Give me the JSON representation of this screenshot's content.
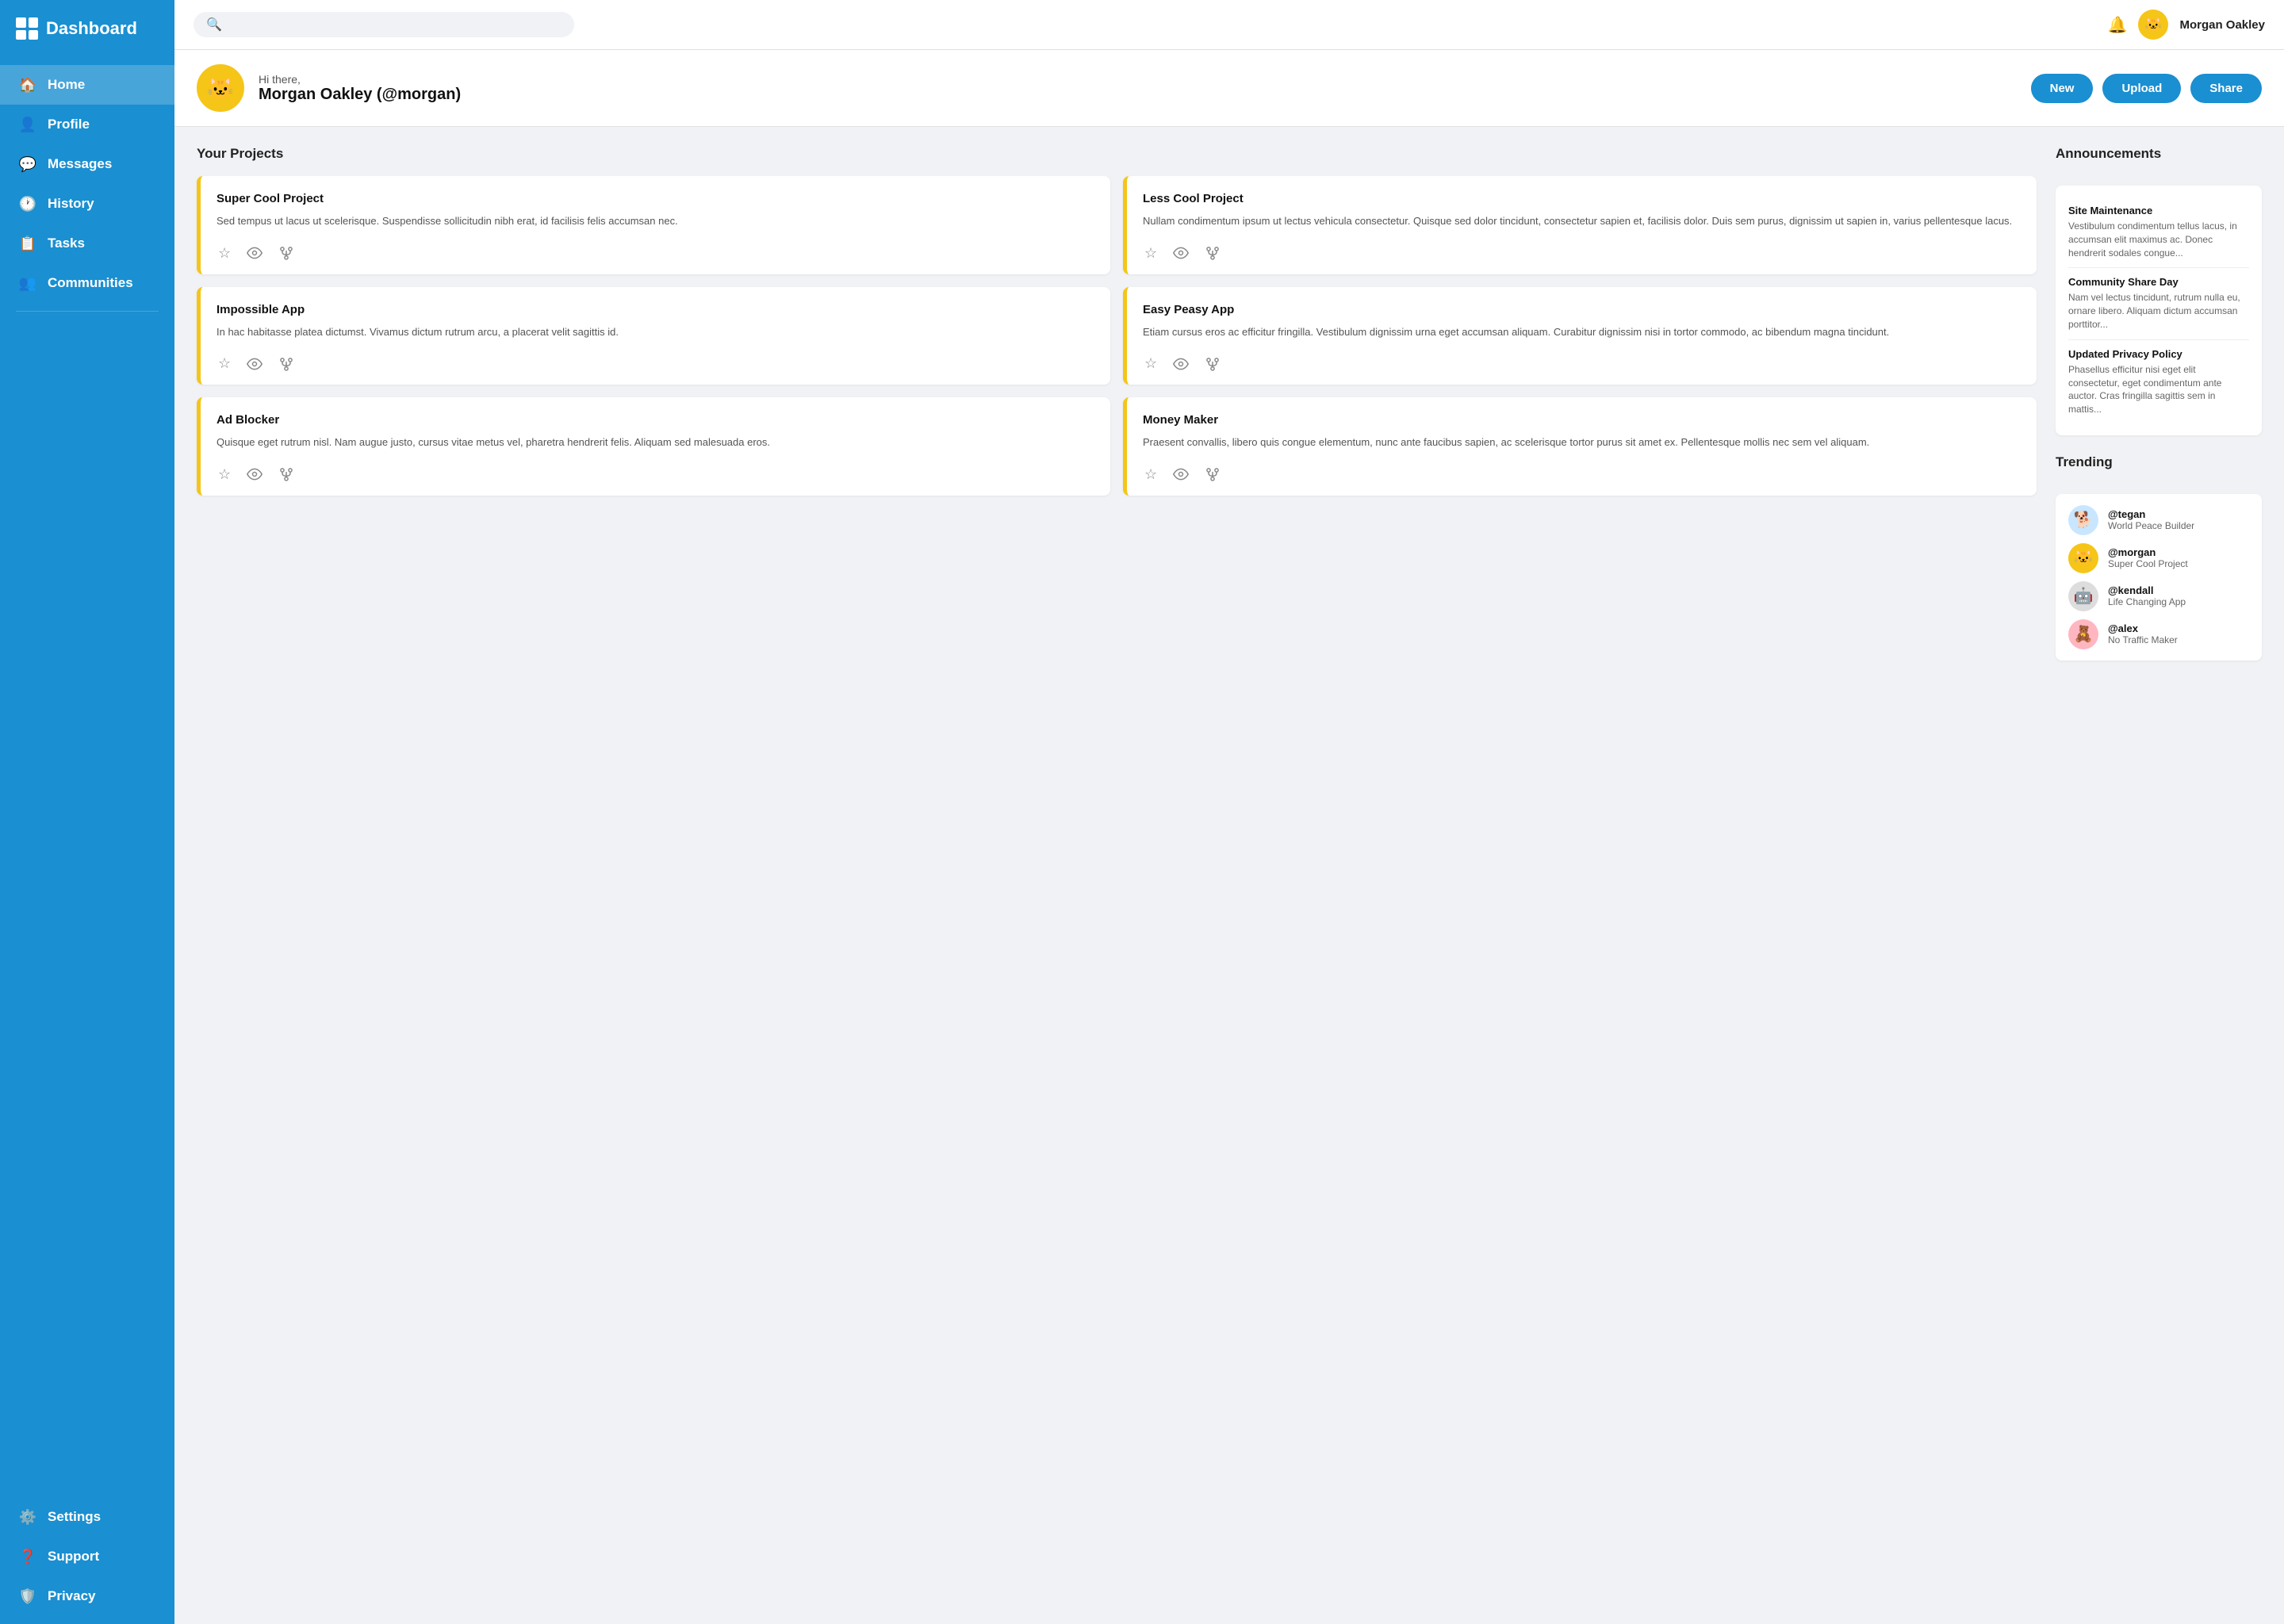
{
  "sidebar": {
    "title": "Dashboard",
    "items": [
      {
        "id": "home",
        "label": "Home",
        "icon": "🏠",
        "active": true
      },
      {
        "id": "profile",
        "label": "Profile",
        "icon": "👤"
      },
      {
        "id": "messages",
        "label": "Messages",
        "icon": "💬"
      },
      {
        "id": "history",
        "label": "History",
        "icon": "🕐"
      },
      {
        "id": "tasks",
        "label": "Tasks",
        "icon": "📋"
      },
      {
        "id": "communities",
        "label": "Communities",
        "icon": "👥"
      }
    ],
    "bottom_items": [
      {
        "id": "settings",
        "label": "Settings",
        "icon": "⚙️"
      },
      {
        "id": "support",
        "label": "Support",
        "icon": "❓"
      },
      {
        "id": "privacy",
        "label": "Privacy",
        "icon": "🛡️"
      }
    ]
  },
  "topbar": {
    "search_placeholder": "",
    "user_name": "Morgan Oakley",
    "user_emoji": "🐱"
  },
  "welcome": {
    "greeting": "Hi there,",
    "user_display": "Morgan Oakley (@morgan)",
    "user_emoji": "🐱",
    "buttons": [
      "New",
      "Upload",
      "Share"
    ]
  },
  "projects_title": "Your Projects",
  "projects": [
    {
      "title": "Super Cool Project",
      "desc": "Sed tempus ut lacus ut scelerisque. Suspendisse sollicitudin nibh erat, id facilisis felis accumsan nec."
    },
    {
      "title": "Less Cool Project",
      "desc": "Nullam condimentum ipsum ut lectus vehicula consectetur. Quisque sed dolor tincidunt, consectetur sapien et, facilisis dolor. Duis sem purus, dignissim ut sapien in, varius pellentesque lacus."
    },
    {
      "title": "Impossible App",
      "desc": "In hac habitasse platea dictumst. Vivamus dictum rutrum arcu, a placerat velit sagittis id."
    },
    {
      "title": "Easy Peasy App",
      "desc": "Etiam cursus eros ac efficitur fringilla. Vestibulum dignissim urna eget accumsan aliquam. Curabitur dignissim nisi in tortor commodo, ac bibendum magna tincidunt."
    },
    {
      "title": "Ad Blocker",
      "desc": "Quisque eget rutrum nisl. Nam augue justo, cursus vitae metus vel, pharetra hendrerit felis. Aliquam sed malesuada eros."
    },
    {
      "title": "Money Maker",
      "desc": "Praesent convallis, libero quis congue elementum, nunc ante faucibus sapien, ac scelerisque tortor purus sit amet ex. Pellentesque mollis nec sem vel aliquam."
    }
  ],
  "announcements_title": "Announcements",
  "announcements": [
    {
      "title": "Site Maintenance",
      "text": "Vestibulum condimentum tellus lacus, in accumsan elit maximus ac. Donec hendrerit sodales congue..."
    },
    {
      "title": "Community Share Day",
      "text": "Nam vel lectus tincidunt, rutrum nulla eu, ornare libero. Aliquam dictum accumsan porttitor..."
    },
    {
      "title": "Updated Privacy Policy",
      "text": "Phasellus efficitur nisi eget elit consectetur, eget condimentum ante auctor. Cras fringilla sagittis sem in mattis..."
    }
  ],
  "trending_title": "Trending",
  "trending": [
    {
      "handle": "@tegan",
      "project": "World Peace Builder",
      "emoji": "🐕",
      "bg": "#c8e6ff"
    },
    {
      "handle": "@morgan",
      "project": "Super Cool Project",
      "emoji": "🐱",
      "bg": "#f5c518"
    },
    {
      "handle": "@kendall",
      "project": "Life Changing App",
      "emoji": "🤖",
      "bg": "#ddd"
    },
    {
      "handle": "@alex",
      "project": "No Traffic Maker",
      "emoji": "🧸",
      "bg": "#ffb6c1"
    }
  ]
}
